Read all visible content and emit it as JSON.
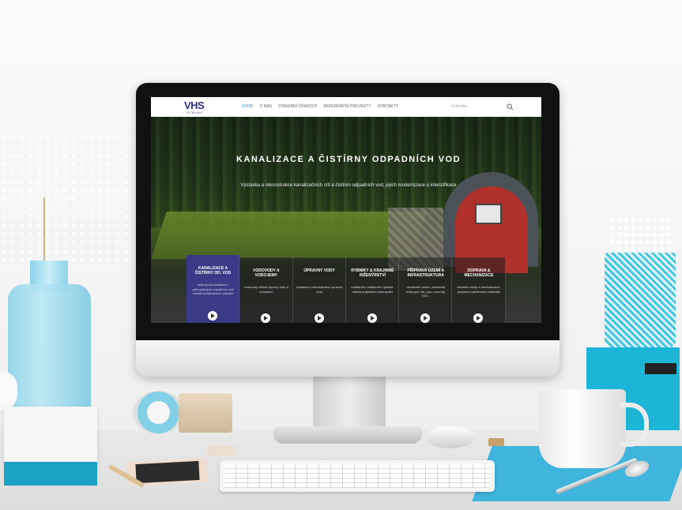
{
  "website": {
    "logo": {
      "main": "VHS",
      "sub": "STAVBY"
    },
    "nav": [
      {
        "label": "ÚVOD",
        "active": true
      },
      {
        "label": "O NÁS",
        "active": false
      },
      {
        "label": "STAVEBNÍ ČINNOSTI",
        "active": false
      },
      {
        "label": "REFERENČNÍ PROJEKTY",
        "active": false
      },
      {
        "label": "KONTAKTY",
        "active": false
      }
    ],
    "search": {
      "placeholder": "Vyhledat..."
    },
    "hero": {
      "title": "KANALIZACE A ČISTÍRNY ODPADNÍCH VOD",
      "subtitle": "Výstavba a rekonstrukce kanalizačních sítí a čistíren odpadních vod, jejich modernizace a intenzifikace"
    },
    "cards": [
      {
        "title": "KANALIZACE A ČISTÍRNY OD. VOD",
        "text": "čistírny komunálních i průmyslových odpadních vod včetně kanalizačních stokáků",
        "active": true
      },
      {
        "title": "VODOVODY A VODOJEMY",
        "text": "vodovody včetně úpravy vody a vodojemů",
        "active": false
      },
      {
        "title": "ÚPRAVNY VODY",
        "text": "výstavba a rekonstrukce úpraven vody",
        "active": false
      },
      {
        "title": "RYBNÍKY & KRAJINNÉ INŽENÝRSTVÍ",
        "text": "odbahnění odbahnění rybníků, stavby krajinného inženýrství",
        "active": false
      },
      {
        "title": "PŘÍPRAVA ÚZEMÍ A INFRASTRUKTURA",
        "text": "osídlování území, dostavba veřejných sítí, plyn, rozvody, TÚV...",
        "active": false
      },
      {
        "title": "DOPRAVA & MECHANIZACE",
        "text": "stavební stroje a mechanizace, přeprava stavebního materiálu",
        "active": false
      }
    ]
  },
  "colors": {
    "brand": "#2d2f86",
    "nav_active": "#2f86c6",
    "card_active": "#3a3a86",
    "bottom_bar": "#37378c"
  }
}
